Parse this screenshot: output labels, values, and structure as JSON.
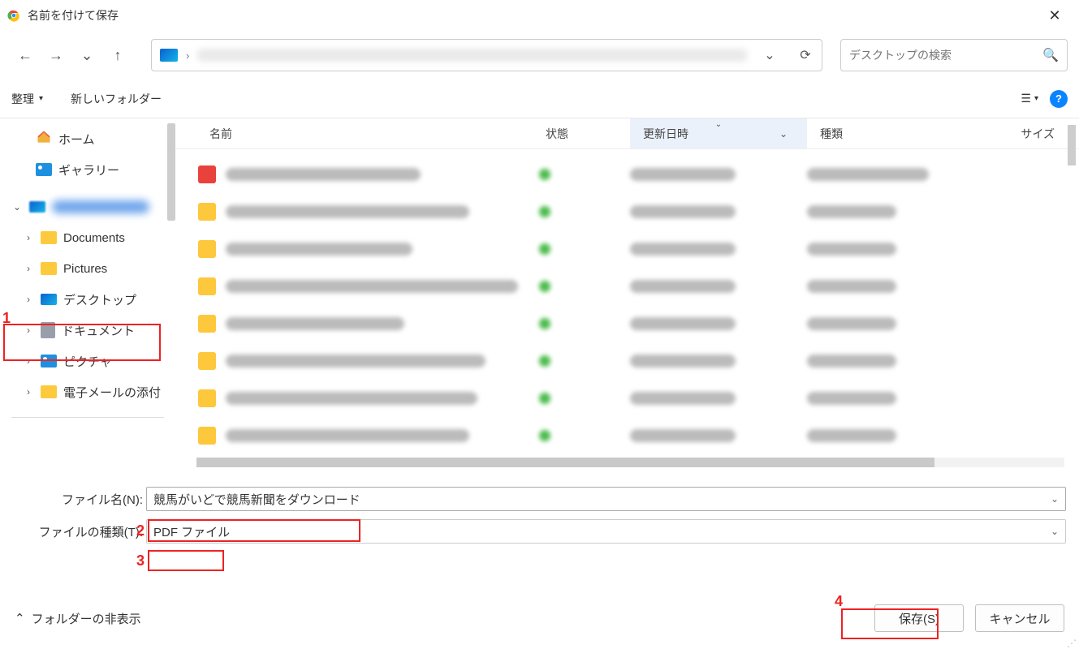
{
  "window": {
    "title": "名前を付けて保存"
  },
  "nav": {
    "search_placeholder": "デスクトップの検索"
  },
  "toolbar": {
    "organize": "整理",
    "new_folder": "新しいフォルダー"
  },
  "tree": {
    "home": "ホーム",
    "gallery": "ギャラリー",
    "documents": "Documents",
    "pictures": "Pictures",
    "desktop": "デスクトップ",
    "documents_jp": "ドキュメント",
    "pictures_jp": "ピクチャ",
    "email_attachments": "電子メールの添付"
  },
  "columns": {
    "name": "名前",
    "status": "状態",
    "modified": "更新日時",
    "type": "種類",
    "size": "サイズ"
  },
  "fields": {
    "filename_label": "ファイル名(N):",
    "filename_value": "競馬がいどで競馬新聞をダウンロード",
    "filetype_label": "ファイルの種類(T):",
    "filetype_value": "PDF ファイル"
  },
  "footer": {
    "hide_folders": "フォルダーの非表示",
    "save": "保存(S)",
    "cancel": "キャンセル"
  },
  "callouts": {
    "c1": "1",
    "c2": "2",
    "c3": "3",
    "c4": "4"
  }
}
